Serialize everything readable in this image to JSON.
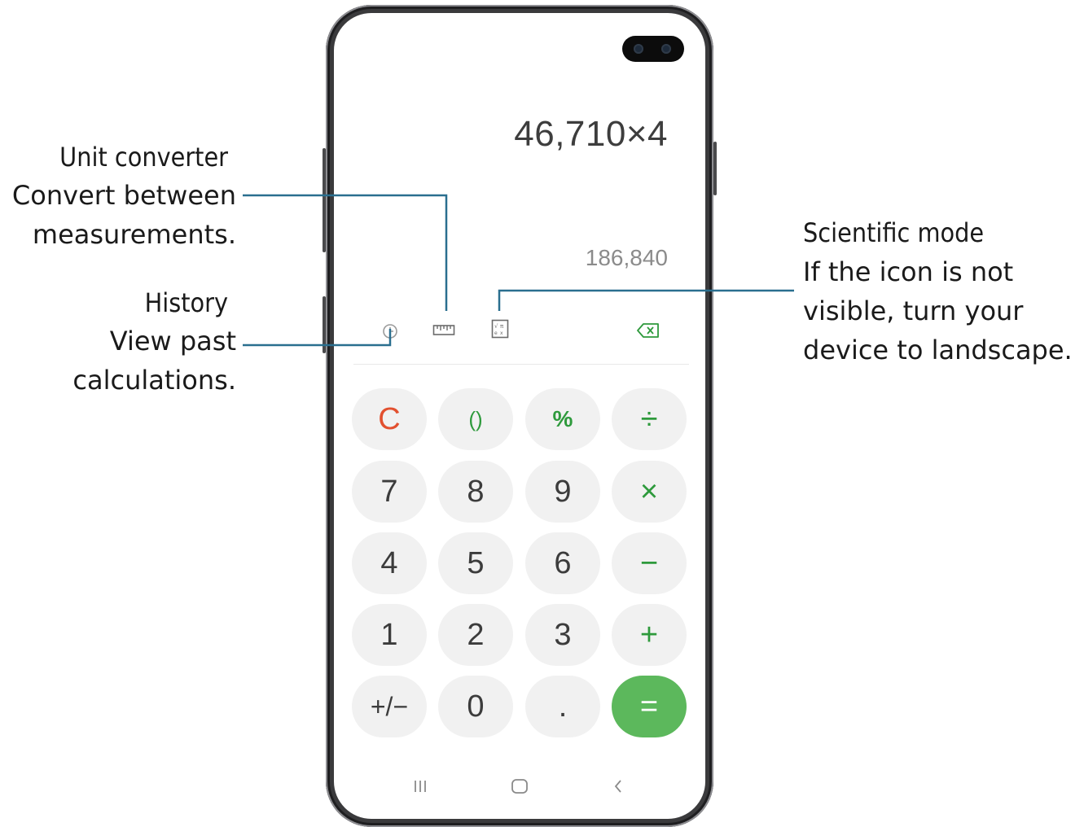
{
  "calculator": {
    "expression": "46,710×4",
    "result": "186,840",
    "toolbar": {
      "history_icon": "clock-icon",
      "unit_converter_icon": "ruler-icon",
      "scientific_icon": "scientific-calculator-icon",
      "backspace_icon": "backspace-icon"
    },
    "keys": {
      "clear": "C",
      "parentheses": "()",
      "percent": "%",
      "divide": "÷",
      "seven": "7",
      "eight": "8",
      "nine": "9",
      "multiply": "×",
      "four": "4",
      "five": "5",
      "six": "6",
      "minus": "−",
      "one": "1",
      "two": "2",
      "three": "3",
      "plus": "+",
      "negate": "+/−",
      "zero": "0",
      "decimal": ".",
      "equals": "="
    },
    "nav": {
      "recents_icon": "recent-apps-icon",
      "home_icon": "home-icon",
      "back_icon": "back-icon"
    },
    "colors": {
      "operator": "#2e9a3c",
      "clear": "#e2502f",
      "equals_bg": "#5cb85c",
      "key_bg": "#f1f1f1",
      "callout_line": "#2a6f8f"
    }
  },
  "callouts": {
    "unit_converter": {
      "title": "Unit converter",
      "desc_line1": "Convert between",
      "desc_line2": "measurements."
    },
    "history": {
      "title": "History",
      "desc_line1": "View past",
      "desc_line2": "calculations."
    },
    "scientific": {
      "title": "Scientific mode",
      "desc_line1": "If the icon is not",
      "desc_line2": "visible, turn your",
      "desc_line3": "device to landscape."
    }
  }
}
